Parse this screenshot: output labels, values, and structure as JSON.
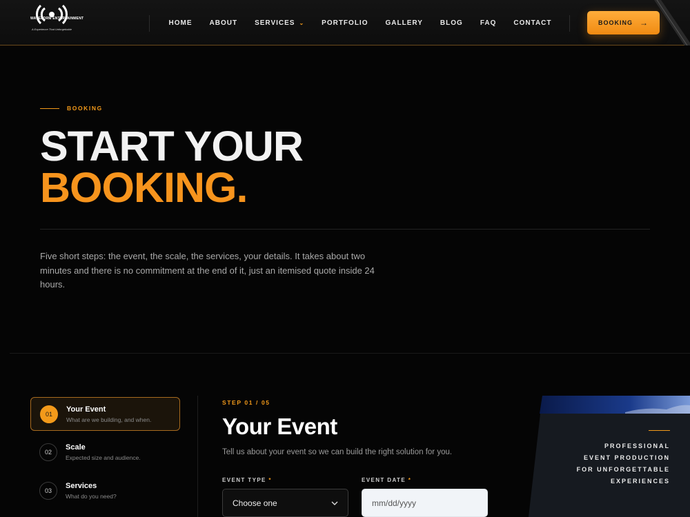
{
  "brand": {
    "name": "WAVEFORM ENTERTAINMENT",
    "tagline": "A Experience That Unforgettable"
  },
  "nav": {
    "items": [
      {
        "label": "HOME"
      },
      {
        "label": "ABOUT"
      },
      {
        "label": "SERVICES",
        "has_dropdown": true
      },
      {
        "label": "PORTFOLIO"
      },
      {
        "label": "GALLERY"
      },
      {
        "label": "BLOG"
      },
      {
        "label": "FAQ"
      },
      {
        "label": "CONTACT"
      }
    ],
    "cta_label": "BOOKING"
  },
  "hero": {
    "eyebrow": "BOOKING",
    "title_line1": "START YOUR",
    "title_line2": "BOOKING.",
    "lead": "Five short steps: the event, the scale, the services, your details. It takes about two minutes and there is no commitment at the end of it, just an itemised quote inside 24 hours."
  },
  "steps": [
    {
      "num": "01",
      "title": "Your Event",
      "desc": "What are we building, and when.",
      "active": true
    },
    {
      "num": "02",
      "title": "Scale",
      "desc": "Expected size and audience.",
      "active": false
    },
    {
      "num": "03",
      "title": "Services",
      "desc": "What do you need?",
      "active": false
    }
  ],
  "form": {
    "step_label": "STEP 01 / 05",
    "title": "Your Event",
    "subtitle": "Tell us about your event so we can build the right solution for you.",
    "event_type": {
      "label": "EVENT TYPE",
      "required_mark": "*",
      "value": "Choose one"
    },
    "event_date": {
      "label": "EVENT DATE",
      "required_mark": "*",
      "placeholder": "mm/dd/yyyy"
    }
  },
  "side_panel": {
    "lines": [
      "PROFESSIONAL",
      "EVENT PRODUCTION",
      "FOR UNFORGETTABLE",
      "EXPERIENCES"
    ]
  },
  "colors": {
    "accent": "#f7941d",
    "background": "#050505",
    "text_muted": "#a9a9a9"
  }
}
